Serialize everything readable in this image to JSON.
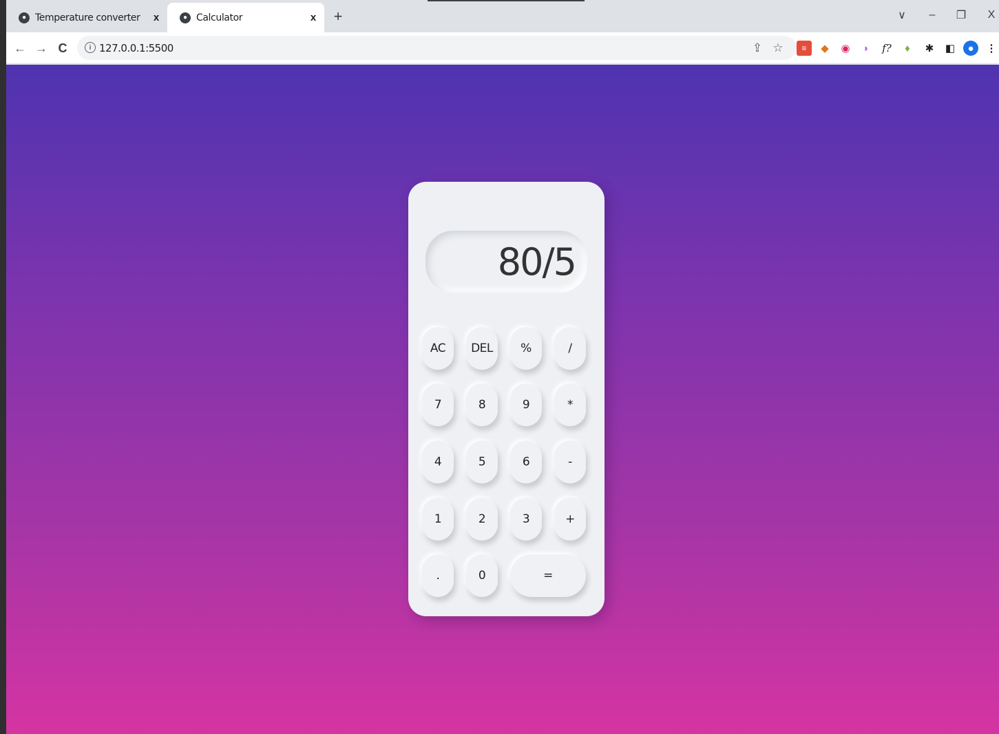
{
  "browser": {
    "tabs": [
      {
        "title": "Temperature converter",
        "close": "x",
        "active": false
      },
      {
        "title": "Calculator",
        "close": "x",
        "active": true
      }
    ],
    "new_tab": "+",
    "window_controls": {
      "tab_search": "∨",
      "minimize": "–",
      "restore": "❐",
      "close": "X"
    },
    "address": "127.0.0.1:5500"
  },
  "calculator": {
    "display": "80/5",
    "keys": [
      {
        "label": "AC"
      },
      {
        "label": "DEL"
      },
      {
        "label": "%"
      },
      {
        "label": "/"
      },
      {
        "label": "7"
      },
      {
        "label": "8"
      },
      {
        "label": "9"
      },
      {
        "label": "*"
      },
      {
        "label": "4"
      },
      {
        "label": "5"
      },
      {
        "label": "6"
      },
      {
        "label": "-"
      },
      {
        "label": "1"
      },
      {
        "label": "2"
      },
      {
        "label": "3"
      },
      {
        "label": "+"
      },
      {
        "label": "."
      },
      {
        "label": "0"
      },
      {
        "label": "="
      }
    ]
  },
  "colors": {
    "gradient_top": "#4f33b0",
    "gradient_bottom": "#d534a2",
    "calculator_bg": "#eef0f3"
  }
}
